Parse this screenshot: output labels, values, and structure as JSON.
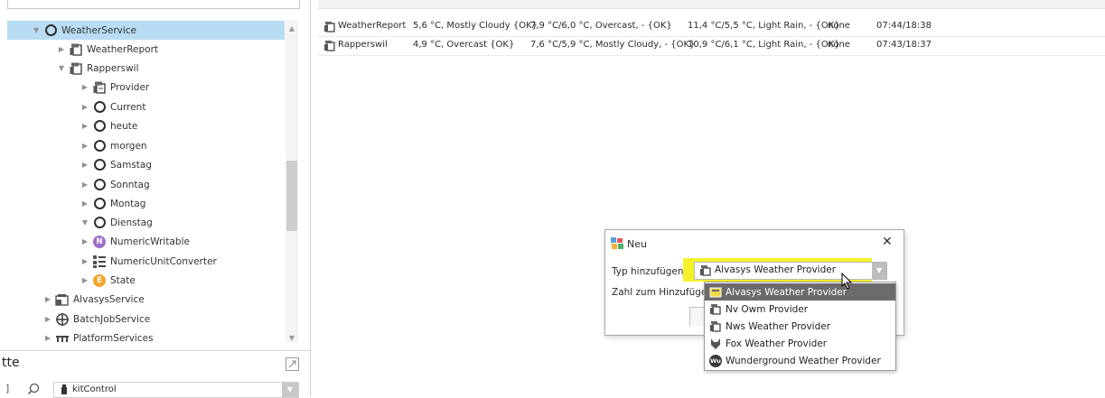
{
  "tree": {
    "items": [
      {
        "label": "WeatherService",
        "icon": "ring-icon",
        "expanded": true,
        "selected": true
      },
      {
        "label": "WeatherReport",
        "icon": "report-icon",
        "expanded": false
      },
      {
        "label": "Rapperswil",
        "icon": "report-icon",
        "expanded": true
      },
      {
        "label": "Provider",
        "icon": "provider-icon",
        "expanded": false
      },
      {
        "label": "Current",
        "icon": "ring-icon",
        "expanded": false
      },
      {
        "label": "heute",
        "icon": "ring-icon",
        "expanded": false
      },
      {
        "label": "morgen",
        "icon": "ring-icon",
        "expanded": false
      },
      {
        "label": "Samstag",
        "icon": "ring-icon",
        "expanded": false
      },
      {
        "label": "Sonntag",
        "icon": "ring-icon",
        "expanded": false
      },
      {
        "label": "Montag",
        "icon": "ring-icon",
        "expanded": false
      },
      {
        "label": "Dienstag",
        "icon": "ring-icon",
        "expanded": true
      },
      {
        "label": "NumericWritable",
        "icon": "numeric-writable-icon",
        "badge": "N",
        "badge_color": "#9b6fc9",
        "expanded": false
      },
      {
        "label": "NumericUnitConverter",
        "icon": "unit-converter-icon",
        "expanded": false
      },
      {
        "label": "State",
        "icon": "state-icon",
        "badge": "E",
        "badge_color": "#f3a52c",
        "expanded": false
      },
      {
        "label": "AlvasysService",
        "icon": "folder-icon",
        "expanded": false
      },
      {
        "label": "BatchJobService",
        "icon": "batch-icon",
        "expanded": false
      },
      {
        "label": "PlatformServices",
        "icon": "platform-icon",
        "expanded": false
      }
    ]
  },
  "palette": {
    "title": "tte",
    "selector_value": "kitControl"
  },
  "table": {
    "rows": [
      {
        "name": "WeatherReport",
        "current": "5,6 °C, Mostly Cloudy {OK}",
        "today": "7,9 °C/6,0 °C, Overcast, - {OK}",
        "tomorrow": "11,4 °C/5,5 °C, Light Rain, - {OK}",
        "alarm": "none",
        "sun": "07:44/18:38"
      },
      {
        "name": "Rapperswil",
        "current": "4,9 °C, Overcast {OK}",
        "today": "7,6 °C/5,9 °C, Mostly Cloudy, - {OK}",
        "tomorrow": "10,9 °C/6,1 °C, Light Rain, - {OK}",
        "alarm": "none",
        "sun": "07:43/18:37"
      }
    ]
  },
  "dialog": {
    "title": "Neu",
    "type_label": "Typ hinzufügen",
    "count_label": "Zahl zum Hinzufügen",
    "selected_value": "Alvasys Weather Provider",
    "highlight_color": "#f6f22a",
    "options": [
      {
        "label": "Alvasys Weather Provider",
        "icon": "provider-icon",
        "active": true
      },
      {
        "label": "Nv Owm Provider",
        "icon": "provider-icon",
        "active": false
      },
      {
        "label": "Nws Weather Provider",
        "icon": "provider-icon",
        "active": false
      },
      {
        "label": "Fox Weather Provider",
        "icon": "fox-icon",
        "active": false
      },
      {
        "label": "Wunderground Weather Provider",
        "icon": "wunderground-icon",
        "badge": "Wu",
        "active": false
      }
    ]
  }
}
